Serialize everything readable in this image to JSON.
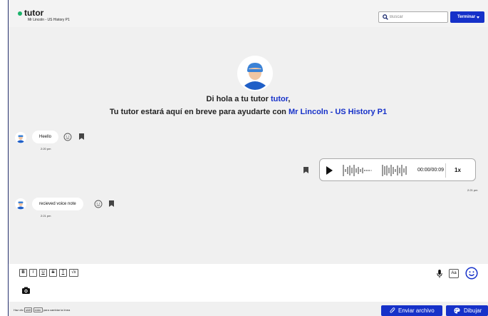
{
  "header": {
    "tutor_name": "tutor",
    "subtitle": "Mr Lincoln - US History P1",
    "search_placeholder": "Buscar",
    "end_button": "Terminar"
  },
  "welcome": {
    "line1_prefix": "Di hola a tu tutor ",
    "line1_name": "tutor",
    "line1_suffix": ",",
    "line2_prefix": "Tu tutor estará aquí en breve para ayudarte con ",
    "line2_class": "Mr Lincoln - US History P1"
  },
  "messages": [
    {
      "text": "Heello",
      "time": "2:20 pm",
      "side": "left"
    },
    {
      "type": "audio",
      "duration": "00:00/00:09",
      "speed": "1x",
      "time": "2:21 pm",
      "side": "right"
    },
    {
      "text": "recieved voice note",
      "time": "2:21 pm",
      "side": "left"
    }
  ],
  "composer": {
    "format_buttons": [
      "B",
      "I",
      "U",
      "S",
      "T",
      "√x"
    ],
    "font_size_button": "Aa"
  },
  "footer": {
    "hint_prefix": "Haz clic ",
    "hint_key1": "shift",
    "hint_key2": "enter",
    "hint_suffix": " para cambiar la línea",
    "send_file": "Enviar archivo",
    "draw": "Dibujar"
  },
  "colors": {
    "accent": "#1631c9",
    "online": "#1bb36b",
    "background": "#f0f0f0"
  },
  "icons": [
    "search-icon",
    "caret-down-icon",
    "tutor-avatar-icon",
    "smiley-icon",
    "bookmark-icon",
    "play-icon",
    "waveform-icon",
    "camera-icon",
    "mic-icon",
    "emoji-icon",
    "paperclip-icon",
    "palette-icon"
  ]
}
